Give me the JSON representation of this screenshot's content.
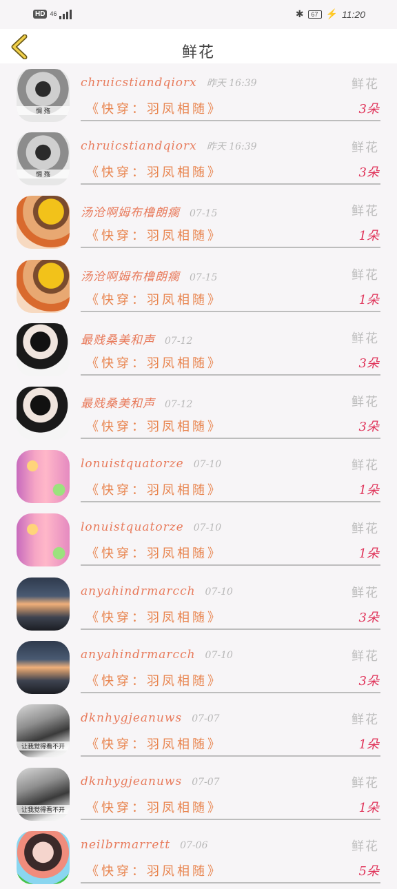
{
  "status": {
    "hd": "HD",
    "network": "46",
    "signal_icon": "signal-icon",
    "bluetooth_icon": "bluetooth-icon",
    "battery": "67",
    "time": "11:20"
  },
  "header": {
    "title": "鲜花",
    "back_icon": "back-chevron-icon"
  },
  "rows": [
    {
      "name": "chruicstiandqiorx",
      "time": "昨天 16:39",
      "kind": "鲜花",
      "book": "《快穿：羽凤相随》",
      "count": "3朵",
      "avatar_caption": "惆 殇"
    },
    {
      "name": "chruicstiandqiorx",
      "time": "昨天 16:39",
      "kind": "鲜花",
      "book": "《快穿：羽凤相随》",
      "count": "3朵",
      "avatar_caption": "惆 殇"
    },
    {
      "name": "汤沧啊姆布橹朗瘸",
      "time": "07-15",
      "kind": "鲜花",
      "book": "《快穿：羽凤相随》",
      "count": "1朵",
      "avatar_caption": ""
    },
    {
      "name": "汤沧啊姆布橹朗瘸",
      "time": "07-15",
      "kind": "鲜花",
      "book": "《快穿：羽凤相随》",
      "count": "1朵",
      "avatar_caption": ""
    },
    {
      "name": "最贱桑美和声",
      "time": "07-12",
      "kind": "鲜花",
      "book": "《快穿：羽凤相随》",
      "count": "3朵",
      "avatar_caption": ""
    },
    {
      "name": "最贱桑美和声",
      "time": "07-12",
      "kind": "鲜花",
      "book": "《快穿：羽凤相随》",
      "count": "3朵",
      "avatar_caption": ""
    },
    {
      "name": "lonuistquatorze",
      "time": "07-10",
      "kind": "鲜花",
      "book": "《快穿：羽凤相随》",
      "count": "1朵",
      "avatar_caption": ""
    },
    {
      "name": "lonuistquatorze",
      "time": "07-10",
      "kind": "鲜花",
      "book": "《快穿：羽凤相随》",
      "count": "1朵",
      "avatar_caption": ""
    },
    {
      "name": "anyahindrmarcch",
      "time": "07-10",
      "kind": "鲜花",
      "book": "《快穿：羽凤相随》",
      "count": "3朵",
      "avatar_caption": ""
    },
    {
      "name": "anyahindrmarcch",
      "time": "07-10",
      "kind": "鲜花",
      "book": "《快穿：羽凤相随》",
      "count": "3朵",
      "avatar_caption": ""
    },
    {
      "name": "dknhygjeanuws",
      "time": "07-07",
      "kind": "鲜花",
      "book": "《快穿：羽凤相随》",
      "count": "1朵",
      "avatar_caption": "让我觉得看不开"
    },
    {
      "name": "dknhygjeanuws",
      "time": "07-07",
      "kind": "鲜花",
      "book": "《快穿：羽凤相随》",
      "count": "1朵",
      "avatar_caption": "让我觉得看不开"
    },
    {
      "name": "neilbrmarrett",
      "time": "07-06",
      "kind": "鲜花",
      "book": "《快穿：羽凤相随》",
      "count": "5朵",
      "avatar_caption": ""
    }
  ]
}
